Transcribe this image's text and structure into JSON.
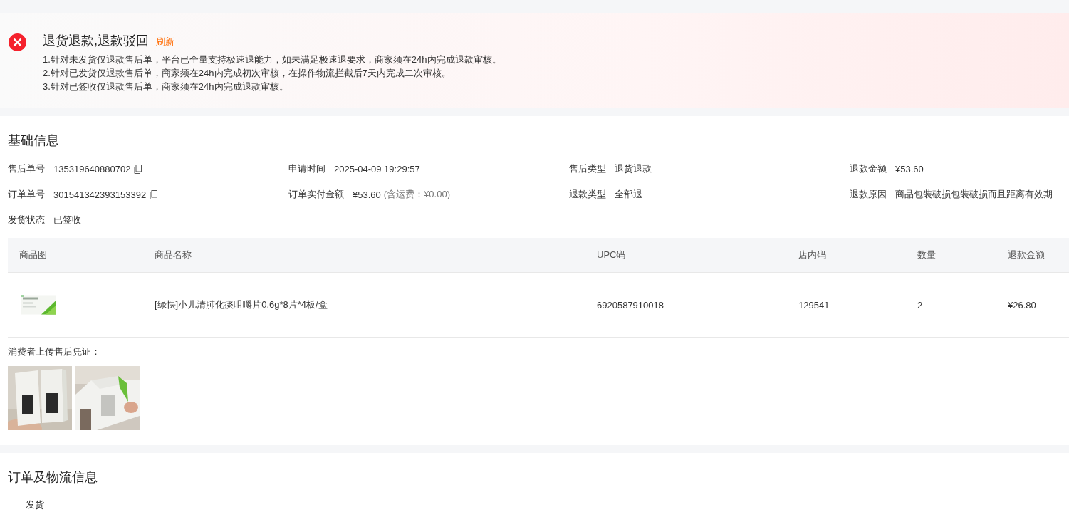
{
  "alert": {
    "title": "退货退款,退款驳回",
    "action": "刷新",
    "lines": [
      "1.针对未发货仅退款售后单，平台已全量支持极速退能力，如未满足极速退要求，商家须在24h内完成退款审核。",
      "2.针对已发货仅退款售后单，商家须在24h内完成初次审核，在操作物流拦截后7天内完成二次审核。",
      "3.针对已签收仅退款售后单，商家须在24h内完成退款审核。"
    ]
  },
  "basic_info": {
    "title": "基础信息",
    "fields": [
      {
        "label": "售后单号",
        "value": "135319640880702",
        "copyable": true
      },
      {
        "label": "申请时间",
        "value": "2025-04-09 19:29:57",
        "copyable": false
      },
      {
        "label": "售后类型",
        "value": "退货退款",
        "copyable": false
      },
      {
        "label": "退款金额",
        "value": "¥53.60",
        "copyable": false
      },
      {
        "label": "订单单号",
        "value": "301541342393153392",
        "copyable": true
      },
      {
        "label": "订单实付金额",
        "value": "¥53.60",
        "note": "(含运费：¥0.00)",
        "copyable": false
      },
      {
        "label": "退款类型",
        "value": "全部退",
        "copyable": false
      },
      {
        "label": "退款原因",
        "value": "商品包装破损包装破损而且距离有效期",
        "copyable": false
      },
      {
        "label": "发货状态",
        "value": "已签收",
        "copyable": false
      }
    ],
    "table": {
      "columns": [
        "商品图",
        "商品名称",
        "UPC码",
        "店内码",
        "数量",
        "退款金额"
      ],
      "rows": [
        {
          "name": "[绿快]小儿清肺化痰咀嚼片0.6g*8片*4板/盒",
          "upc": "6920587910018",
          "store_code": "129541",
          "quantity": "2",
          "refund": "¥26.80"
        }
      ]
    },
    "evidence": {
      "label": "消费者上传售后凭证："
    }
  },
  "order_logistics": {
    "title": "订单及物流信息",
    "status": "发货"
  }
}
